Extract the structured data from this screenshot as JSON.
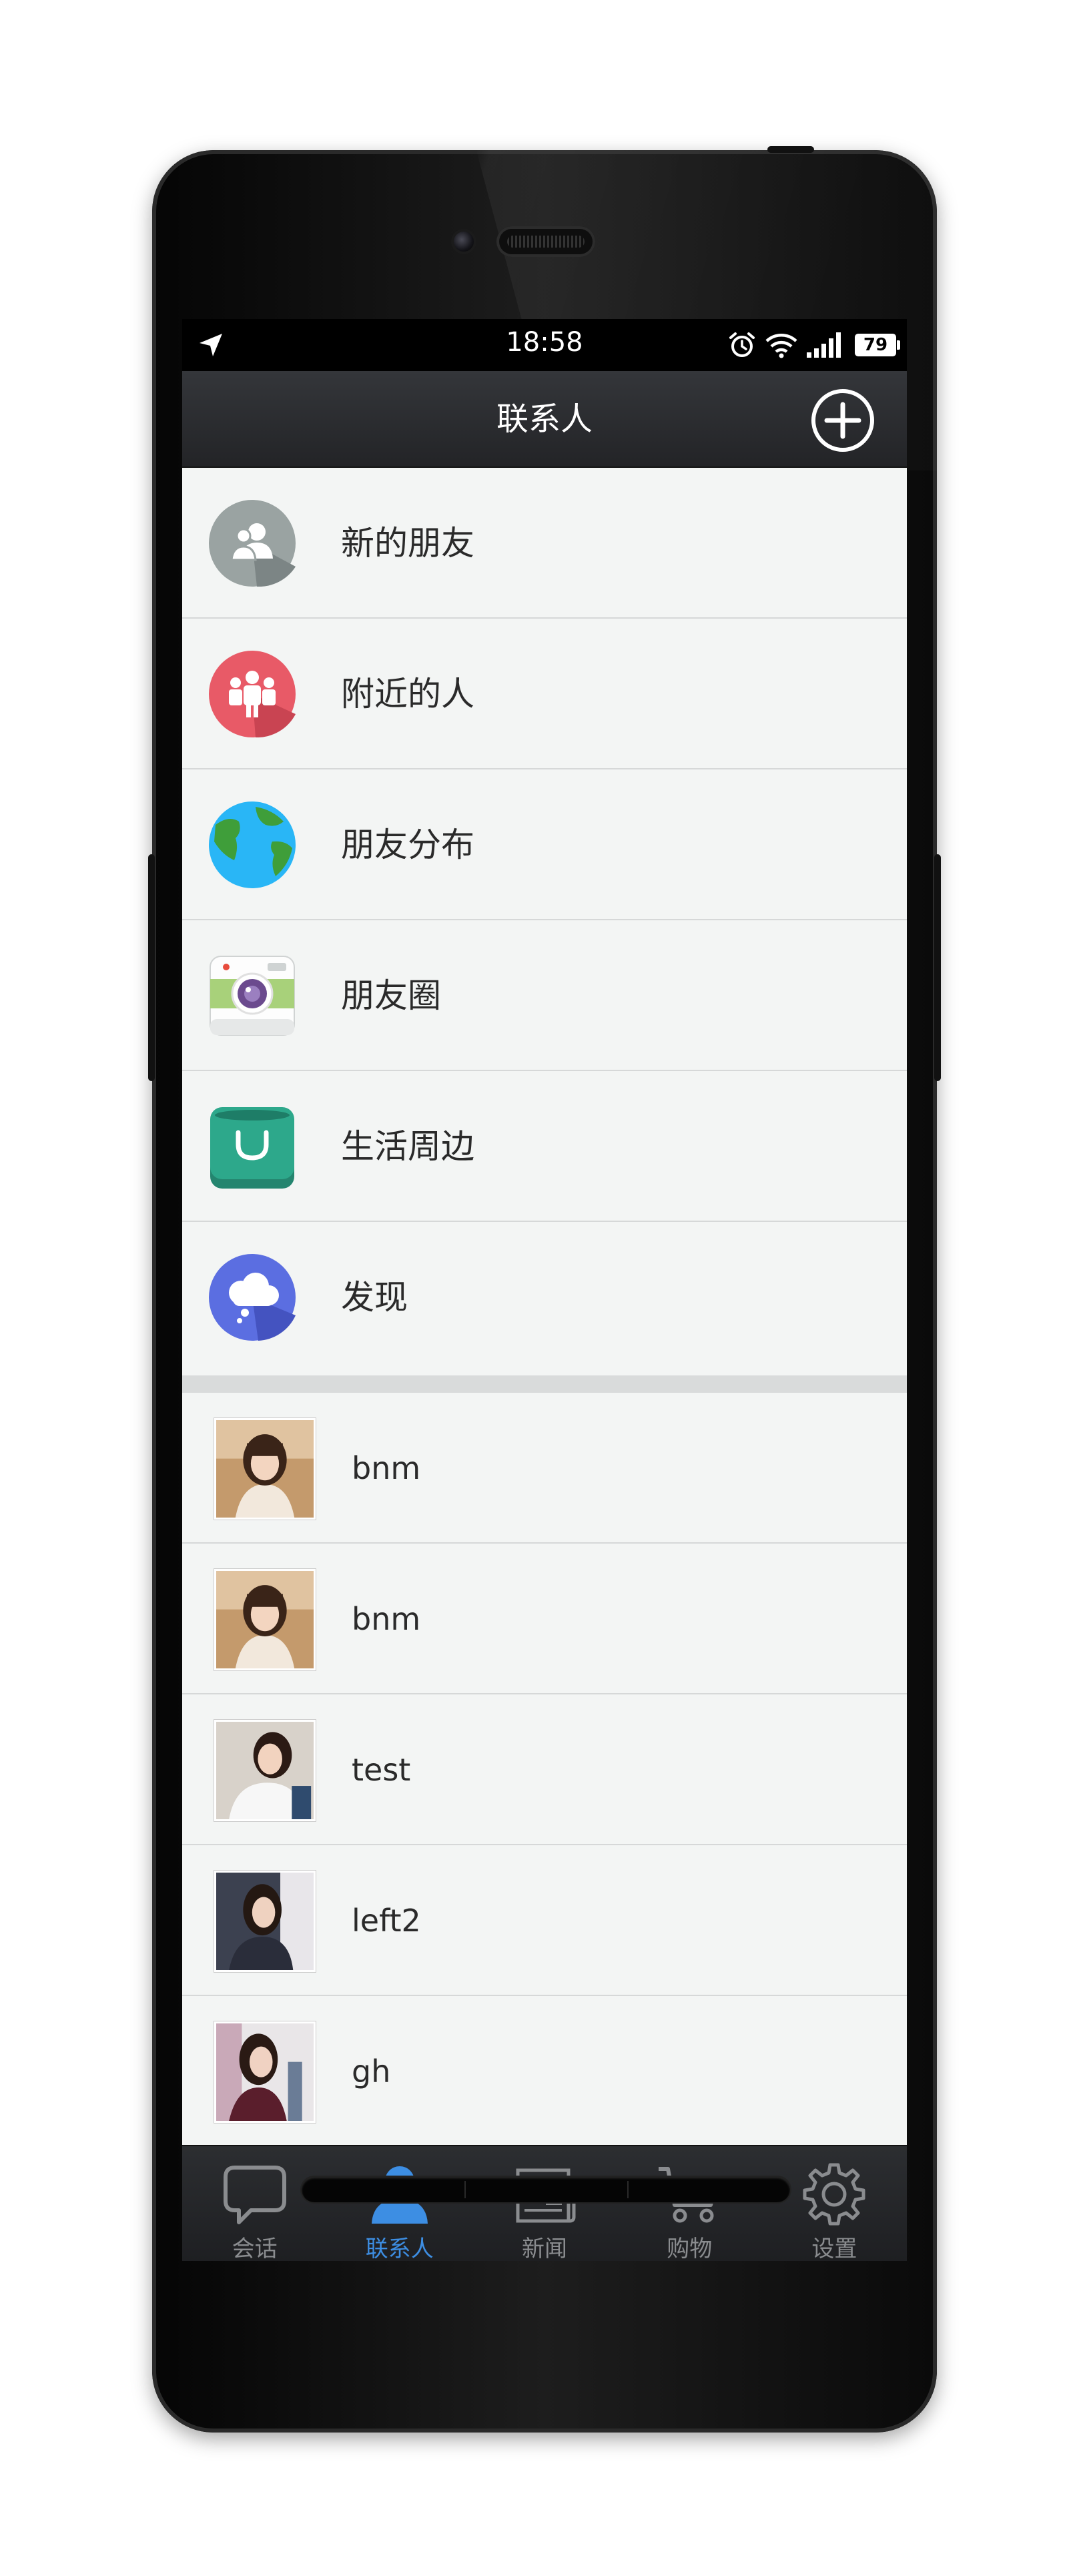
{
  "status_bar": {
    "time": "18:58",
    "battery": "79"
  },
  "nav": {
    "title": "联系人"
  },
  "menu_items": [
    {
      "label": "新的朋友",
      "icon": "new-friends-icon"
    },
    {
      "label": "附近的人",
      "icon": "nearby-people-icon"
    },
    {
      "label": "朋友分布",
      "icon": "globe-icon"
    },
    {
      "label": "朋友圈",
      "icon": "camera-icon"
    },
    {
      "label": "生活周边",
      "icon": "shopping-bag-icon"
    },
    {
      "label": "发现",
      "icon": "cloud-icon"
    }
  ],
  "contacts": [
    {
      "name": "bnm"
    },
    {
      "name": "bnm"
    },
    {
      "name": "test"
    },
    {
      "name": "left2"
    },
    {
      "name": "gh"
    }
  ],
  "tabs": [
    {
      "label": "会话",
      "icon": "chat-bubble-icon",
      "active": false
    },
    {
      "label": "联系人",
      "icon": "person-icon",
      "active": true
    },
    {
      "label": "新闻",
      "icon": "newspaper-icon",
      "active": false
    },
    {
      "label": "购物",
      "icon": "cart-icon",
      "active": false
    },
    {
      "label": "设置",
      "icon": "gear-icon",
      "active": false
    }
  ],
  "colors": {
    "active_tab": "#3d8ee3",
    "inactive_tab": "#8a8c8f",
    "nav_bar": "#2c2e31",
    "list_background": "#f3f5f4"
  }
}
